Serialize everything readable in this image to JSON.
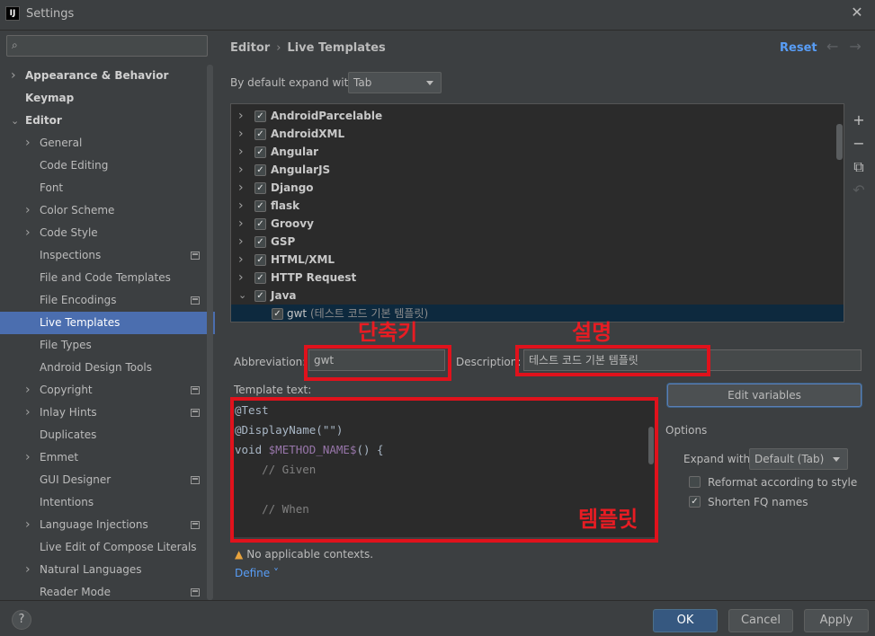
{
  "window": {
    "title": "Settings",
    "app_icon": "intellij-icon"
  },
  "search": {
    "placeholder": "",
    "icon": "search-icon"
  },
  "sidebar": {
    "items": [
      {
        "label": "Appearance & Behavior",
        "level": 0,
        "arrow": "collapsed",
        "bold": true
      },
      {
        "label": "Keymap",
        "level": 0,
        "arrow": "none",
        "bold": true
      },
      {
        "label": "Editor",
        "level": 0,
        "arrow": "expanded",
        "bold": true
      },
      {
        "label": "General",
        "level": 1,
        "arrow": "collapsed"
      },
      {
        "label": "Code Editing",
        "level": 1,
        "arrow": "none"
      },
      {
        "label": "Font",
        "level": 1,
        "arrow": "none"
      },
      {
        "label": "Color Scheme",
        "level": 1,
        "arrow": "collapsed"
      },
      {
        "label": "Code Style",
        "level": 1,
        "arrow": "collapsed"
      },
      {
        "label": "Inspections",
        "level": 1,
        "arrow": "none",
        "project": true
      },
      {
        "label": "File and Code Templates",
        "level": 1,
        "arrow": "none"
      },
      {
        "label": "File Encodings",
        "level": 1,
        "arrow": "none",
        "project": true
      },
      {
        "label": "Live Templates",
        "level": 1,
        "arrow": "none",
        "selected": true
      },
      {
        "label": "File Types",
        "level": 1,
        "arrow": "none"
      },
      {
        "label": "Android Design Tools",
        "level": 1,
        "arrow": "none"
      },
      {
        "label": "Copyright",
        "level": 1,
        "arrow": "collapsed",
        "project": true
      },
      {
        "label": "Inlay Hints",
        "level": 1,
        "arrow": "collapsed",
        "project": true
      },
      {
        "label": "Duplicates",
        "level": 1,
        "arrow": "none"
      },
      {
        "label": "Emmet",
        "level": 1,
        "arrow": "collapsed"
      },
      {
        "label": "GUI Designer",
        "level": 1,
        "arrow": "none",
        "project": true
      },
      {
        "label": "Intentions",
        "level": 1,
        "arrow": "none"
      },
      {
        "label": "Language Injections",
        "level": 1,
        "arrow": "collapsed",
        "project": true
      },
      {
        "label": "Live Edit of Compose Literals",
        "level": 1,
        "arrow": "none"
      },
      {
        "label": "Natural Languages",
        "level": 1,
        "arrow": "collapsed"
      },
      {
        "label": "Reader Mode",
        "level": 1,
        "arrow": "none",
        "project": true
      }
    ]
  },
  "header": {
    "breadcrumb_parent": "Editor",
    "breadcrumb_sep": "›",
    "breadcrumb_current": "Live Templates",
    "reset_label": "Reset",
    "back_arrow": "←",
    "forward_arrow": "→"
  },
  "expand": {
    "label": "By default expand with",
    "value": "Tab"
  },
  "templates": [
    {
      "name": "AndroidParcelable",
      "checked": true,
      "expanded": false
    },
    {
      "name": "AndroidXML",
      "checked": true,
      "expanded": false
    },
    {
      "name": "Angular",
      "checked": true,
      "expanded": false
    },
    {
      "name": "AngularJS",
      "checked": true,
      "expanded": false
    },
    {
      "name": "Django",
      "checked": true,
      "expanded": false
    },
    {
      "name": "flask",
      "checked": true,
      "expanded": false
    },
    {
      "name": "Groovy",
      "checked": true,
      "expanded": false
    },
    {
      "name": "GSP",
      "checked": true,
      "expanded": false
    },
    {
      "name": "HTML/XML",
      "checked": true,
      "expanded": false
    },
    {
      "name": "HTTP Request",
      "checked": true,
      "expanded": false
    },
    {
      "name": "Java",
      "checked": true,
      "expanded": true
    }
  ],
  "template_child": {
    "name": "gwt",
    "desc": "(테스트 코드 기본 템플릿)",
    "checked": true
  },
  "side_tools": [
    "+",
    "−",
    "⧉",
    "↶"
  ],
  "abbreviation": {
    "label": "Abbreviation:",
    "value": "gwt"
  },
  "description": {
    "label": "Description:",
    "value": "테스트 코드 기본 템플릿"
  },
  "template_text": {
    "label": "Template text:",
    "lines": [
      [
        {
          "t": "@Test",
          "c": ""
        }
      ],
      [
        {
          "t": "@DisplayName(\"\")",
          "c": ""
        }
      ],
      [
        {
          "t": "void ",
          "c": ""
        },
        {
          "t": "$METHOD_NAME$",
          "c": "var"
        },
        {
          "t": "() {",
          "c": ""
        }
      ],
      [
        {
          "t": "    // Given",
          "c": "cm"
        }
      ],
      [
        {
          "t": "",
          "c": ""
        }
      ],
      [
        {
          "t": "    // When",
          "c": "cm"
        }
      ]
    ]
  },
  "contexts": {
    "warning": "No applicable contexts.",
    "define_label": "Define ˅"
  },
  "edit_variables_label": "Edit variables",
  "options": {
    "title": "Options",
    "expand_with_label": "Expand with",
    "expand_with_value": "Default (Tab)",
    "reformat_label": "Reformat according to style",
    "reformat_checked": false,
    "shorten_label": "Shorten FQ names",
    "shorten_checked": true
  },
  "annotations": {
    "abbrev": "단축키",
    "desc": "설명",
    "template": "템플릿",
    "color": "#e0121c"
  },
  "footer": {
    "help": "?",
    "ok": "OK",
    "cancel": "Cancel",
    "apply": "Apply"
  }
}
